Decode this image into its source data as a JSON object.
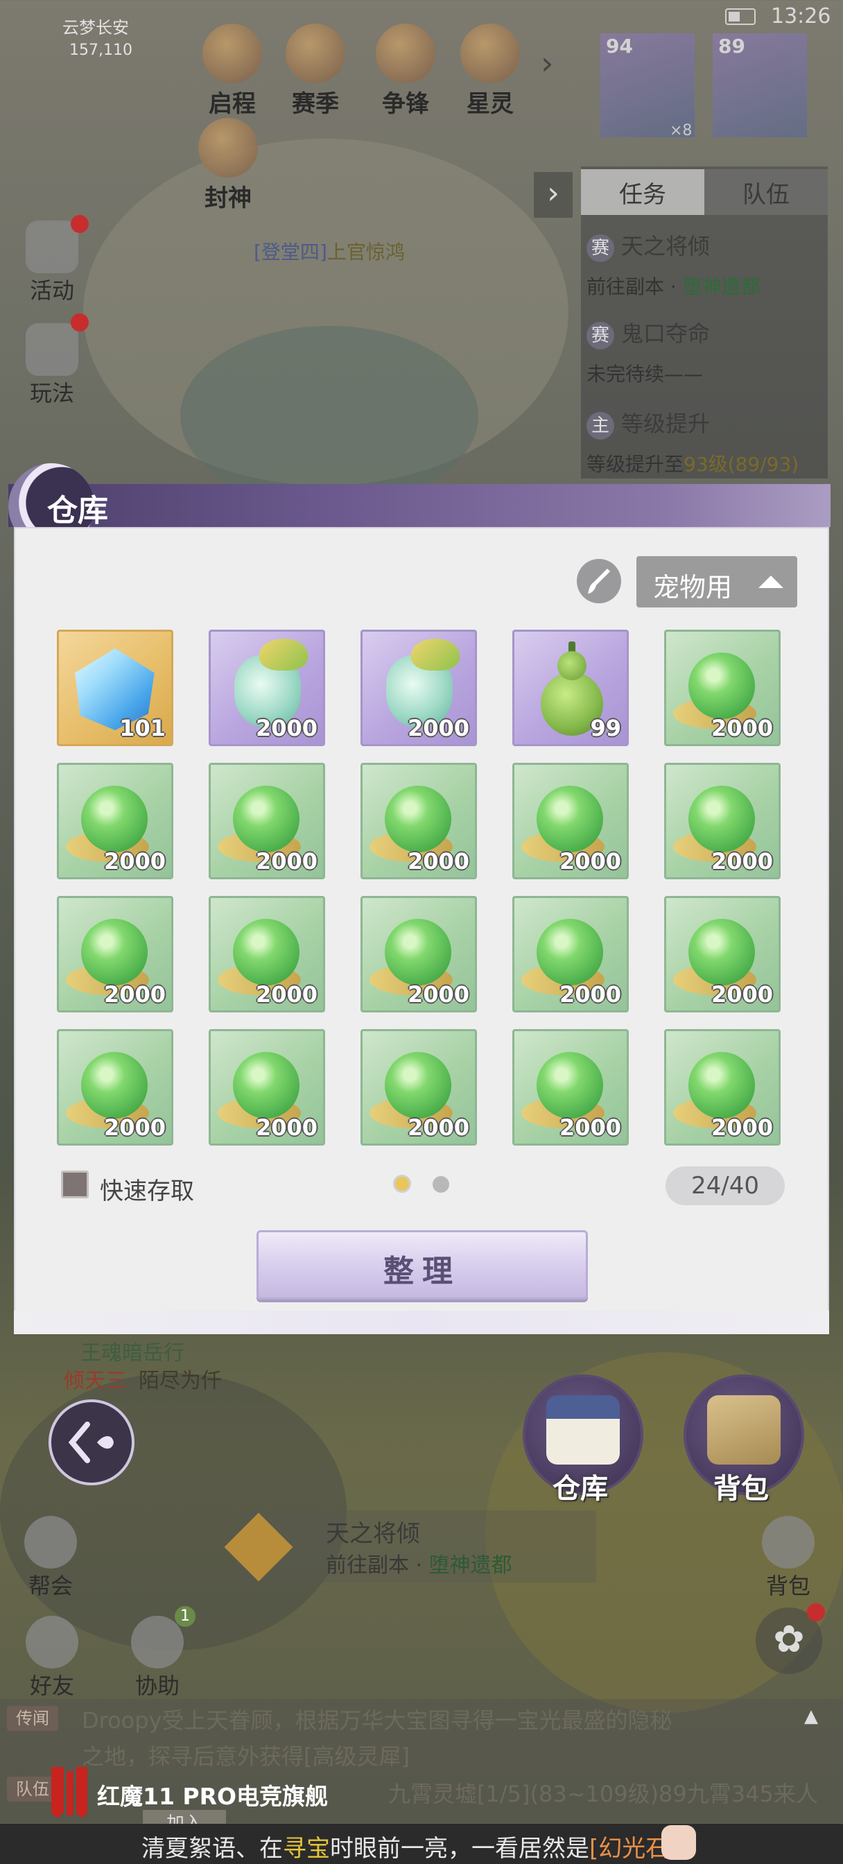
{
  "status_bar": {
    "time": "13:26"
  },
  "hud": {
    "location": "云梦长安",
    "coordinates": "157,110",
    "top_buttons": [
      "启程",
      "赛季",
      "争锋",
      "星灵"
    ],
    "extra_button": "封神",
    "left_buttons": [
      "活动",
      "玩法"
    ],
    "party": [
      {
        "level": "94",
        "extra": "×8"
      },
      {
        "level": "89"
      }
    ],
    "npc_name_prefix": "[登堂四]",
    "npc_name": "上官惊鸿"
  },
  "quest_panel": {
    "tabs": [
      "任务",
      "队伍"
    ],
    "quests": [
      {
        "badge": "赛",
        "title": "天之将倾",
        "desc_prefix": "前往副本 · ",
        "desc_highlight": "堕神遗都"
      },
      {
        "badge": "赛",
        "title": "鬼口夺命",
        "desc_prefix": "未完待续——",
        "desc_highlight": ""
      },
      {
        "badge": "主",
        "title": "等级提升",
        "desc_prefix": "等级提升至",
        "desc_highlight": "93级(89/93)"
      }
    ]
  },
  "warehouse": {
    "title": "仓库",
    "filter_label": "宠物用",
    "items": [
      {
        "type": "gold",
        "icon": "blue-gem-icon",
        "qty": "101"
      },
      {
        "type": "purple",
        "icon": "spirit-bottle-icon",
        "qty": "2000"
      },
      {
        "type": "purple",
        "icon": "spirit-bottle-icon",
        "qty": "2000"
      },
      {
        "type": "purple",
        "icon": "green-gourd-icon",
        "qty": "99"
      },
      {
        "type": "green",
        "icon": "green-pearl-icon",
        "qty": "2000"
      },
      {
        "type": "green",
        "icon": "green-pearl-icon",
        "qty": "2000"
      },
      {
        "type": "green",
        "icon": "green-pearl-icon",
        "qty": "2000"
      },
      {
        "type": "green",
        "icon": "green-pearl-icon",
        "qty": "2000"
      },
      {
        "type": "green",
        "icon": "green-pearl-icon",
        "qty": "2000"
      },
      {
        "type": "green",
        "icon": "green-pearl-icon",
        "qty": "2000"
      },
      {
        "type": "green",
        "icon": "green-pearl-icon",
        "qty": "2000"
      },
      {
        "type": "green",
        "icon": "green-pearl-icon",
        "qty": "2000"
      },
      {
        "type": "green",
        "icon": "green-pearl-icon",
        "qty": "2000"
      },
      {
        "type": "green",
        "icon": "green-pearl-icon",
        "qty": "2000"
      },
      {
        "type": "green",
        "icon": "green-pearl-icon",
        "qty": "2000"
      },
      {
        "type": "green",
        "icon": "green-pearl-icon",
        "qty": "2000"
      },
      {
        "type": "green",
        "icon": "green-pearl-icon",
        "qty": "2000"
      },
      {
        "type": "green",
        "icon": "green-pearl-icon",
        "qty": "2000"
      },
      {
        "type": "green",
        "icon": "green-pearl-icon",
        "qty": "2000"
      },
      {
        "type": "green",
        "icon": "green-pearl-icon",
        "qty": "2000"
      }
    ],
    "quick_access_label": "快速存取",
    "page_indicator": {
      "current": 1,
      "total": 2
    },
    "capacity": "24/40",
    "sort_button": "整理"
  },
  "bottom_hud": {
    "warehouse_button": "仓库",
    "backpack_button": "背包",
    "quest_tracker_title": "天之将倾",
    "quest_tracker_desc_prefix": "前往副本 · ",
    "quest_tracker_desc_highlight": "堕神遗都",
    "side_buttons": [
      "帮会",
      "好友",
      "协助",
      "背包"
    ],
    "friend_badge": "1",
    "chat_lines": [
      {
        "tag": "传闻",
        "text": "Droopy受上天眷顾，根据万华大宝图寻得一宝光最盛的隐秘"
      },
      {
        "tag": "",
        "text": "之地，探寻后意外获得[高级灵犀]"
      },
      {
        "tag": "队伍",
        "text": "九霄灵墟[1/5](83~109级)89九霄345来人"
      }
    ],
    "chat_misc": [
      "王魂暗岳行",
      "倾天三",
      "陌尽为仟"
    ],
    "join_button": "加入",
    "brand_text": "红魔11 PRO电竞旗舰",
    "ticker": {
      "prefix": "清夏絮语、在",
      "highlight": "寻宝",
      "middle": "时眼前一亮，一看居然是",
      "item": "[幻光石]"
    }
  }
}
